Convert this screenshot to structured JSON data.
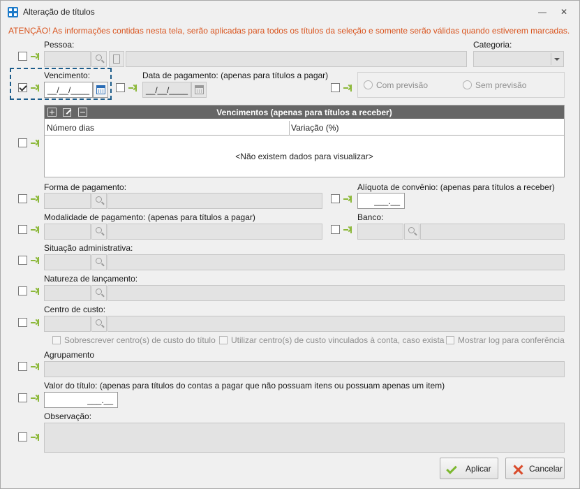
{
  "window": {
    "title": "Alteração de títulos",
    "minimize_glyph": "—",
    "close_glyph": "✕"
  },
  "warning": "ATENÇÃO! As informações contidas nesta tela, serão aplicadas para todos os títulos da seleção e somente serão válidas quando estiverem marcadas.",
  "labels": {
    "pessoa": "Pessoa:",
    "categoria": "Categoria:",
    "vencimento": "Vencimento:",
    "data_pagamento": "Data de pagamento: (apenas para títulos a pagar)",
    "forma_pagamento": "Forma de pagamento:",
    "aliquota": "Alíquota de convênio: (apenas para títulos a receber)",
    "modalidade": "Modalidade de pagamento: (apenas para títulos a pagar)",
    "banco": "Banco:",
    "situacao": "Situação administrativa:",
    "natureza": "Natureza de lançamento:",
    "centro_custo": "Centro de custo:",
    "agrupamento": "Agrupamento",
    "valor_titulo": "Valor do título: (apenas para títulos do contas a pagar que não possuam itens ou possuam apenas um item)",
    "observacao": "Observação:"
  },
  "inputs": {
    "vencimento_mask": "__/__/____",
    "data_pagamento_mask": "__/__/____",
    "aliquota_mask": "___.__",
    "valor_mask": "___.__"
  },
  "radios": {
    "com_previsao": "Com previsão",
    "sem_previsao": "Sem previsão"
  },
  "grid": {
    "title": "Vencimentos (apenas para títulos a receber)",
    "columns": [
      "Número dias",
      "Variação (%)"
    ],
    "empty": "<Não existem dados para visualizar>"
  },
  "centro_options": {
    "sobrescrever": "Sobrescrever centro(s) de custo do título",
    "utilizar": "Utilizar centro(s) de custo vinculados à conta, caso exista",
    "mostrar_log": "Mostrar log para conferência"
  },
  "buttons": {
    "aplicar": "Aplicar",
    "cancelar": "Cancelar"
  },
  "checkboxes": {
    "pessoa": false,
    "vencimento": true,
    "data_pagamento": false,
    "previsao": false,
    "vencimentos_grid": false,
    "forma_pagamento": false,
    "aliquota": false,
    "modalidade": false,
    "banco": false,
    "situacao": false,
    "natureza": false,
    "centro_custo": false,
    "agrupamento": false,
    "valor": false,
    "observacao": false
  },
  "colors": {
    "warning": "#d9541e",
    "arrow": "#8cb83a",
    "grid_header": "#666666",
    "accent_border": "#1c5c8a"
  }
}
